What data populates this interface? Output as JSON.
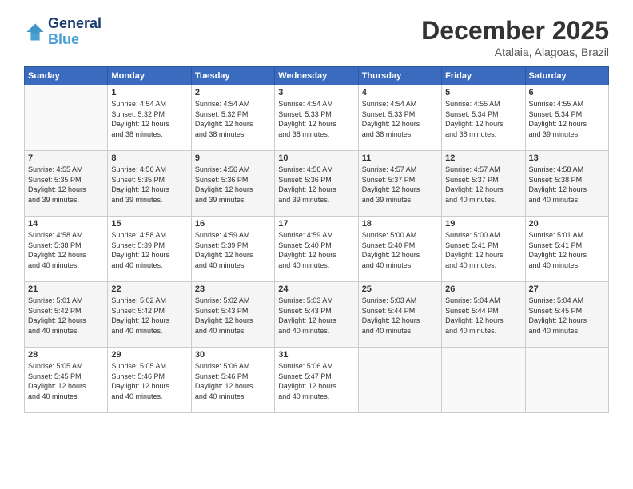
{
  "logo": {
    "line1": "General",
    "line2": "Blue"
  },
  "title": "December 2025",
  "location": "Atalaia, Alagoas, Brazil",
  "days_header": [
    "Sunday",
    "Monday",
    "Tuesday",
    "Wednesday",
    "Thursday",
    "Friday",
    "Saturday"
  ],
  "weeks": [
    {
      "shaded": false,
      "days": [
        {
          "num": "",
          "info": ""
        },
        {
          "num": "1",
          "info": "Sunrise: 4:54 AM\nSunset: 5:32 PM\nDaylight: 12 hours\nand 38 minutes."
        },
        {
          "num": "2",
          "info": "Sunrise: 4:54 AM\nSunset: 5:32 PM\nDaylight: 12 hours\nand 38 minutes."
        },
        {
          "num": "3",
          "info": "Sunrise: 4:54 AM\nSunset: 5:33 PM\nDaylight: 12 hours\nand 38 minutes."
        },
        {
          "num": "4",
          "info": "Sunrise: 4:54 AM\nSunset: 5:33 PM\nDaylight: 12 hours\nand 38 minutes."
        },
        {
          "num": "5",
          "info": "Sunrise: 4:55 AM\nSunset: 5:34 PM\nDaylight: 12 hours\nand 38 minutes."
        },
        {
          "num": "6",
          "info": "Sunrise: 4:55 AM\nSunset: 5:34 PM\nDaylight: 12 hours\nand 39 minutes."
        }
      ]
    },
    {
      "shaded": true,
      "days": [
        {
          "num": "7",
          "info": "Sunrise: 4:55 AM\nSunset: 5:35 PM\nDaylight: 12 hours\nand 39 minutes."
        },
        {
          "num": "8",
          "info": "Sunrise: 4:56 AM\nSunset: 5:35 PM\nDaylight: 12 hours\nand 39 minutes."
        },
        {
          "num": "9",
          "info": "Sunrise: 4:56 AM\nSunset: 5:36 PM\nDaylight: 12 hours\nand 39 minutes."
        },
        {
          "num": "10",
          "info": "Sunrise: 4:56 AM\nSunset: 5:36 PM\nDaylight: 12 hours\nand 39 minutes."
        },
        {
          "num": "11",
          "info": "Sunrise: 4:57 AM\nSunset: 5:37 PM\nDaylight: 12 hours\nand 39 minutes."
        },
        {
          "num": "12",
          "info": "Sunrise: 4:57 AM\nSunset: 5:37 PM\nDaylight: 12 hours\nand 40 minutes."
        },
        {
          "num": "13",
          "info": "Sunrise: 4:58 AM\nSunset: 5:38 PM\nDaylight: 12 hours\nand 40 minutes."
        }
      ]
    },
    {
      "shaded": false,
      "days": [
        {
          "num": "14",
          "info": "Sunrise: 4:58 AM\nSunset: 5:38 PM\nDaylight: 12 hours\nand 40 minutes."
        },
        {
          "num": "15",
          "info": "Sunrise: 4:58 AM\nSunset: 5:39 PM\nDaylight: 12 hours\nand 40 minutes."
        },
        {
          "num": "16",
          "info": "Sunrise: 4:59 AM\nSunset: 5:39 PM\nDaylight: 12 hours\nand 40 minutes."
        },
        {
          "num": "17",
          "info": "Sunrise: 4:59 AM\nSunset: 5:40 PM\nDaylight: 12 hours\nand 40 minutes."
        },
        {
          "num": "18",
          "info": "Sunrise: 5:00 AM\nSunset: 5:40 PM\nDaylight: 12 hours\nand 40 minutes."
        },
        {
          "num": "19",
          "info": "Sunrise: 5:00 AM\nSunset: 5:41 PM\nDaylight: 12 hours\nand 40 minutes."
        },
        {
          "num": "20",
          "info": "Sunrise: 5:01 AM\nSunset: 5:41 PM\nDaylight: 12 hours\nand 40 minutes."
        }
      ]
    },
    {
      "shaded": true,
      "days": [
        {
          "num": "21",
          "info": "Sunrise: 5:01 AM\nSunset: 5:42 PM\nDaylight: 12 hours\nand 40 minutes."
        },
        {
          "num": "22",
          "info": "Sunrise: 5:02 AM\nSunset: 5:42 PM\nDaylight: 12 hours\nand 40 minutes."
        },
        {
          "num": "23",
          "info": "Sunrise: 5:02 AM\nSunset: 5:43 PM\nDaylight: 12 hours\nand 40 minutes."
        },
        {
          "num": "24",
          "info": "Sunrise: 5:03 AM\nSunset: 5:43 PM\nDaylight: 12 hours\nand 40 minutes."
        },
        {
          "num": "25",
          "info": "Sunrise: 5:03 AM\nSunset: 5:44 PM\nDaylight: 12 hours\nand 40 minutes."
        },
        {
          "num": "26",
          "info": "Sunrise: 5:04 AM\nSunset: 5:44 PM\nDaylight: 12 hours\nand 40 minutes."
        },
        {
          "num": "27",
          "info": "Sunrise: 5:04 AM\nSunset: 5:45 PM\nDaylight: 12 hours\nand 40 minutes."
        }
      ]
    },
    {
      "shaded": false,
      "days": [
        {
          "num": "28",
          "info": "Sunrise: 5:05 AM\nSunset: 5:45 PM\nDaylight: 12 hours\nand 40 minutes."
        },
        {
          "num": "29",
          "info": "Sunrise: 5:05 AM\nSunset: 5:46 PM\nDaylight: 12 hours\nand 40 minutes."
        },
        {
          "num": "30",
          "info": "Sunrise: 5:06 AM\nSunset: 5:46 PM\nDaylight: 12 hours\nand 40 minutes."
        },
        {
          "num": "31",
          "info": "Sunrise: 5:06 AM\nSunset: 5:47 PM\nDaylight: 12 hours\nand 40 minutes."
        },
        {
          "num": "",
          "info": ""
        },
        {
          "num": "",
          "info": ""
        },
        {
          "num": "",
          "info": ""
        }
      ]
    }
  ]
}
